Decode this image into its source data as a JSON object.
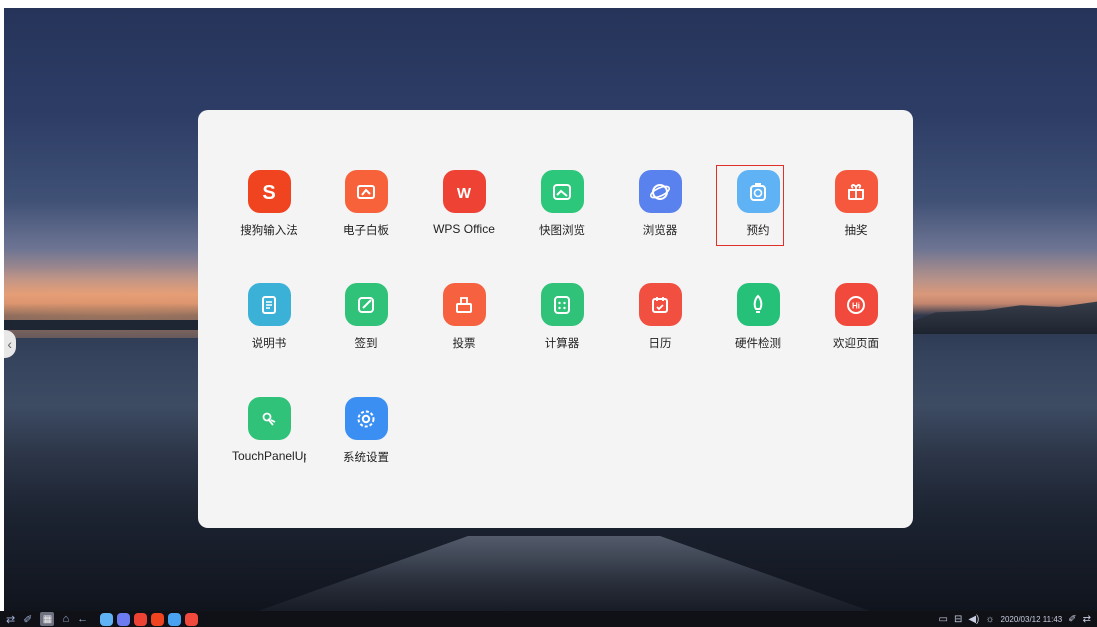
{
  "apps": [
    {
      "label": "搜狗输入法",
      "color": "#f0431f",
      "icon": "sogou-s-icon"
    },
    {
      "label": "电子白板",
      "color": "#f7623a",
      "icon": "whiteboard-icon"
    },
    {
      "label": "WPS Office",
      "color": "#ee4235",
      "icon": "wps-w-icon"
    },
    {
      "label": "快图浏览",
      "color": "#2cc77a",
      "icon": "image-viewer-icon"
    },
    {
      "label": "浏览器",
      "color": "#5a82ee",
      "icon": "browser-globe-icon"
    },
    {
      "label": "预约",
      "color": "#5fb3f4",
      "icon": "reservation-clock-icon"
    },
    {
      "label": "抽奖",
      "color": "#f5583c",
      "icon": "gift-box-icon"
    },
    {
      "label": "说明书",
      "color": "#3cb1d8",
      "icon": "manual-book-icon"
    },
    {
      "label": "签到",
      "color": "#2fc278",
      "icon": "check-in-pen-icon"
    },
    {
      "label": "投票",
      "color": "#f6613f",
      "icon": "ballot-box-icon"
    },
    {
      "label": "计算器",
      "color": "#2fc278",
      "icon": "calculator-icon"
    },
    {
      "label": "日历",
      "color": "#f15040",
      "icon": "calendar-icon"
    },
    {
      "label": "硬件检测",
      "color": "#25c179",
      "icon": "rocket-hardware-icon"
    },
    {
      "label": "欢迎页面",
      "color": "#f14a3c",
      "icon": "hi-welcome-icon"
    },
    {
      "label": "TouchPanelUp",
      "color": "#2fc278",
      "icon": "touch-panel-icon"
    },
    {
      "label": "系统设置",
      "color": "#3c8ff2",
      "icon": "settings-gear-icon"
    }
  ],
  "taskbar": {
    "left_icons": [
      "swap-arrows-icon",
      "pin-icon",
      "app-grid-icon",
      "home-icon",
      "back-arrow-icon"
    ],
    "running_apps": [
      {
        "icon": "running-reservation-icon",
        "color": "#5fb3f4"
      },
      {
        "icon": "running-browser-icon",
        "color": "#6c7cf0"
      },
      {
        "icon": "running-wps-icon",
        "color": "#ee4235"
      },
      {
        "icon": "running-sogou-icon",
        "color": "#f0431f"
      },
      {
        "icon": "running-app-icon",
        "color": "#4aa3f0"
      },
      {
        "icon": "running-welcome-icon",
        "color": "#f14a3c"
      }
    ],
    "datetime": "2020/03/12  11:43"
  },
  "colors": {
    "panel": "#f4f4f4",
    "highlight": "#e0302a"
  }
}
